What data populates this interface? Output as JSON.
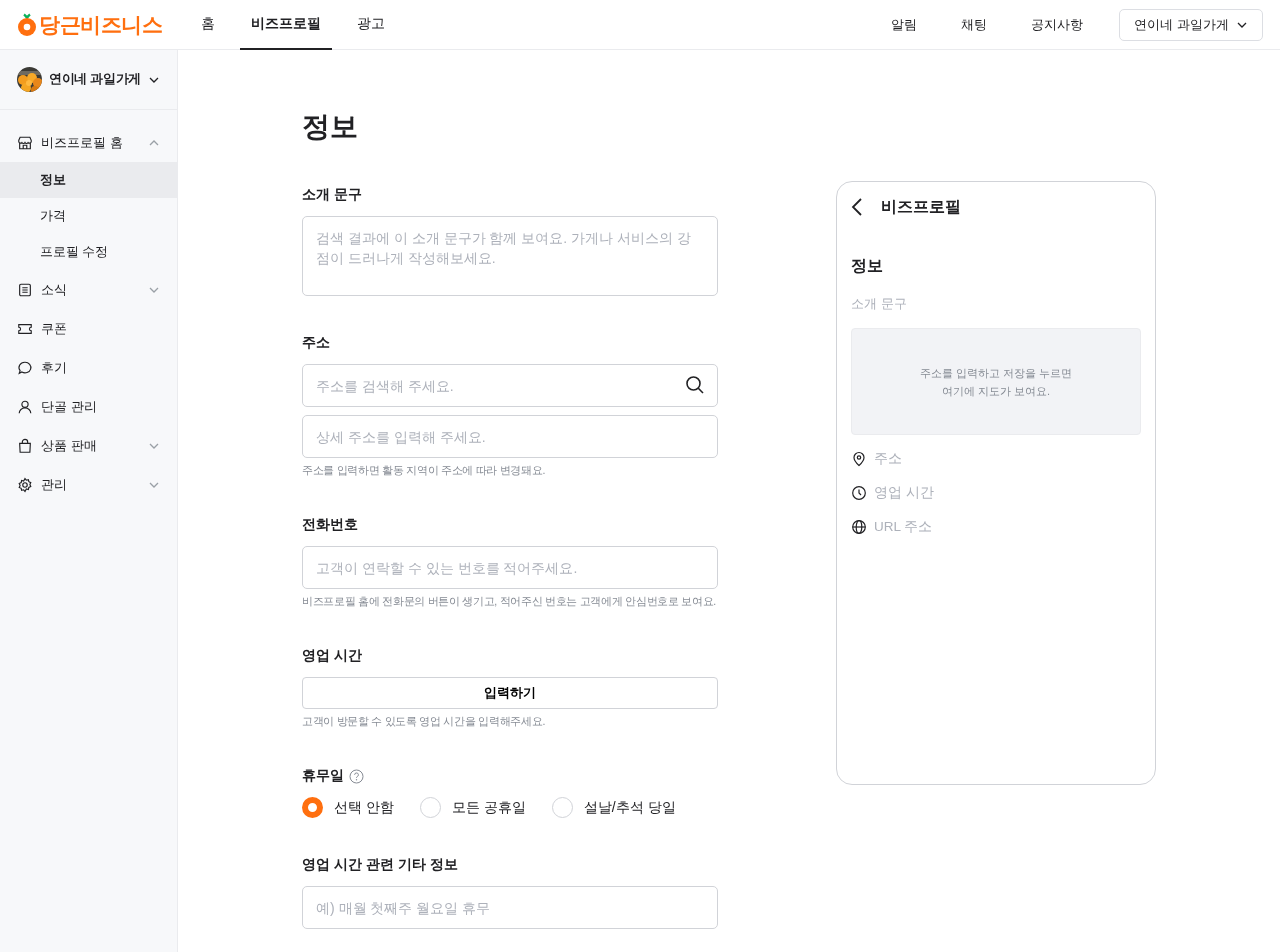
{
  "header": {
    "logo": "당근비즈니스",
    "nav": [
      {
        "label": "홈",
        "selected": false
      },
      {
        "label": "비즈프로필",
        "selected": true
      },
      {
        "label": "광고",
        "selected": false
      }
    ],
    "links": [
      "알림",
      "채팅",
      "공지사항"
    ],
    "store_select": "연이네 과일가게"
  },
  "sidebar": {
    "store": {
      "name": "연이네 과일가게"
    },
    "items": [
      {
        "label": "비즈프로필 홈",
        "expanded": true,
        "children": [
          {
            "label": "정보",
            "selected": true
          },
          {
            "label": "가격",
            "selected": false
          },
          {
            "label": "프로필 수정",
            "selected": false
          }
        ]
      },
      {
        "label": "소식",
        "expanded": false
      },
      {
        "label": "쿠폰"
      },
      {
        "label": "후기"
      },
      {
        "label": "단골 관리"
      },
      {
        "label": "상품 판매",
        "expanded": false
      },
      {
        "label": "관리",
        "expanded": false
      }
    ]
  },
  "page": {
    "title": "정보",
    "sections": [
      {
        "kind": "textarea",
        "label": "소개 문구",
        "placeholder": "검색 결과에 이 소개 문구가 함께 보여요. 가게나 서비스의 강점이 드러나게 작성해보세요."
      },
      {
        "kind": "address",
        "label": "주소",
        "placeholders": [
          "주소를 검색해 주세요.",
          "상세 주소를 입력해 주세요."
        ],
        "help": "주소를 입력하면 활동 지역이 주소에 따라 변경돼요."
      },
      {
        "kind": "text",
        "label": "전화번호",
        "placeholder": "고객이 연락할 수 있는 번호를 적어주세요.",
        "help": "비즈프로필 홈에 전화문의 버튼이 생기고, 적어주신 번호는 고객에게 안심번호로 보여요."
      },
      {
        "kind": "button",
        "label": "영업 시간",
        "button": "입력하기",
        "help": "고객이 방문할 수 있도록 영업 시간을 입력해주세요."
      },
      {
        "kind": "radio",
        "label": "휴무일",
        "help_icon": true,
        "options": [
          {
            "label": "선택 안함",
            "selected": true
          },
          {
            "label": "모든 공휴일",
            "selected": false
          },
          {
            "label": "설날/추석 당일",
            "selected": false
          }
        ]
      },
      {
        "kind": "text",
        "label": "영업 시간 관련 기타 정보",
        "placeholder": "예) 매월 첫째주 월요일 휴무"
      }
    ]
  },
  "preview": {
    "title": "비즈프로필",
    "heading": "정보",
    "intro": "소개 문구",
    "map_text": "주소를 입력하고 저장을 누르면\n여기에 지도가 보여요.",
    "rows": [
      "주소",
      "영업 시간",
      "URL 주소"
    ]
  }
}
